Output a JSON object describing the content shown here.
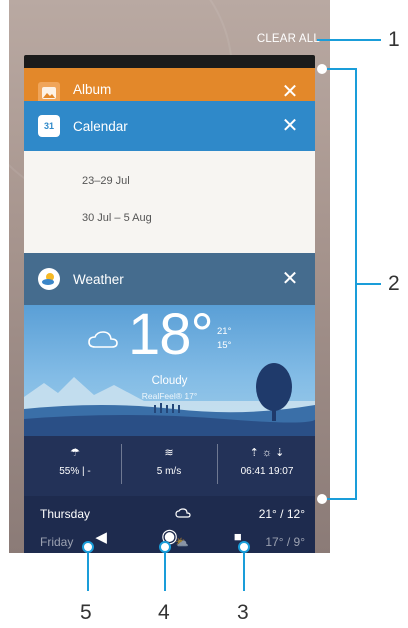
{
  "clear_all": "CLEAR ALL",
  "cards": {
    "album": {
      "title": "Album",
      "color": "#e3882a"
    },
    "calendar": {
      "title": "Calendar",
      "day_icon": "31",
      "color": "#2f89c9",
      "entries": [
        "23–29 Jul",
        "30 Jul – 5 Aug"
      ]
    },
    "weather": {
      "title": "Weather",
      "temp": "18°",
      "high": "21°",
      "low": "15°",
      "condition": "Cloudy",
      "realfeel": "RealFeel® 17°",
      "stats": [
        {
          "icon": "umbrella-icon",
          "value": "55% | -"
        },
        {
          "icon": "wind-icon",
          "value": "5 m/s"
        },
        {
          "icon": "sunrise-sunset-icon",
          "value": "06:41  19:07"
        }
      ],
      "forecast": [
        {
          "day": "Thursday",
          "icon": "cloud-icon",
          "temps": "21° / 12°"
        },
        {
          "day": "Friday",
          "icon": "sun-cloud-icon",
          "temps": "17° / 9°"
        }
      ]
    }
  },
  "nav": {
    "back": "◀",
    "home": "◉",
    "recent": "■"
  },
  "callouts": [
    "1",
    "2",
    "3",
    "4",
    "5"
  ],
  "accent": "#1a9dd9"
}
